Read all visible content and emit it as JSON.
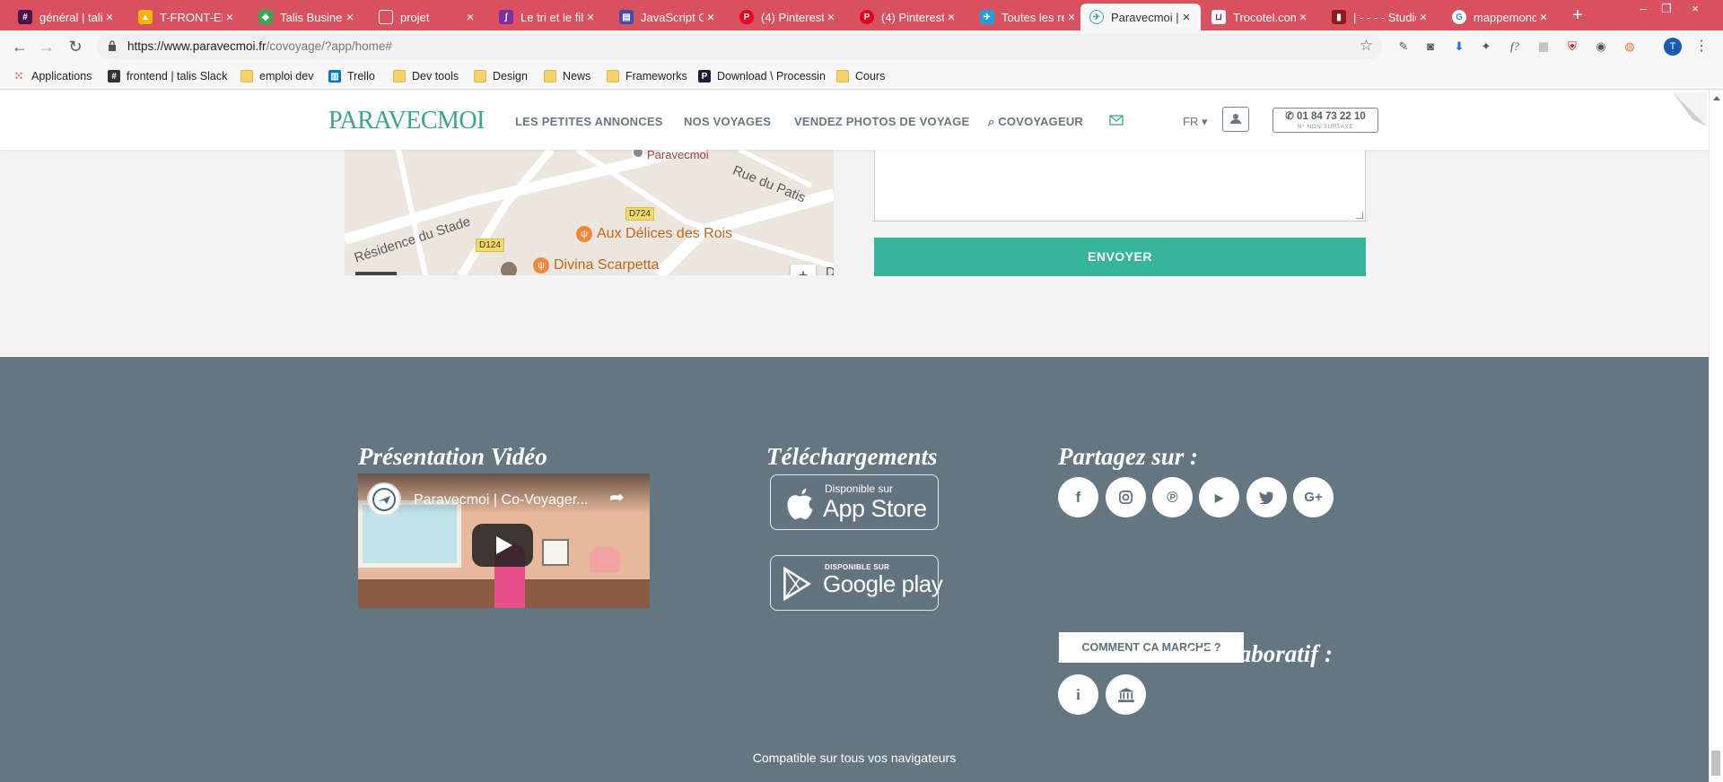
{
  "browser": {
    "tabs": [
      {
        "label": "général | talis",
        "favicon": "slack-icon",
        "color": "#4a154b"
      },
      {
        "label": "T-FRONT-EN",
        "favicon": "drive-icon",
        "color": "#f4b400"
      },
      {
        "label": "Talis Busines",
        "favicon": "maps-icon",
        "color": "#34a853"
      },
      {
        "label": "projet",
        "favicon": "doc-icon",
        "color": "#ffffff"
      },
      {
        "label": "Le tri et le filt",
        "favicon": "bookmark-icon",
        "color": "#7b2fa1"
      },
      {
        "label": "JavaScript Gr",
        "favicon": "js-icon",
        "color": "#3d4fa8"
      },
      {
        "label": "(4) Pinterest",
        "favicon": "pinterest-icon",
        "color": "#e60023"
      },
      {
        "label": "(4) Pinterest",
        "favicon": "pinterest-icon",
        "color": "#e60023"
      },
      {
        "label": "Toutes les re",
        "favicon": "bird-icon",
        "color": "#1e9fd8"
      },
      {
        "label": "Paravecmoi |",
        "favicon": "paravecmoi-icon",
        "color": "#3aa58f",
        "active": true
      },
      {
        "label": "Trocotel.com",
        "favicon": "trocotel-icon",
        "color": "#c8102e"
      },
      {
        "label": "| - - - - Studio",
        "favicon": "studio-icon",
        "color": "#8b1a1a"
      },
      {
        "label": "mappemonde",
        "favicon": "google-icon",
        "color": "#4285f4"
      }
    ],
    "new_tab": "+",
    "url_host": "https://www.paravecmoi.fr",
    "url_path": "/covoyage/?app/home#",
    "bookmarks": [
      {
        "label": "Applications",
        "icon": "apps-grid-icon"
      },
      {
        "label": "frontend | talis Slack",
        "icon": "slack-icon"
      },
      {
        "label": "emploi dev",
        "icon": "folder-icon"
      },
      {
        "label": "Trello",
        "icon": "trello-icon"
      },
      {
        "label": "Dev tools",
        "icon": "folder-icon"
      },
      {
        "label": "Design",
        "icon": "folder-icon"
      },
      {
        "label": "News",
        "icon": "folder-icon"
      },
      {
        "label": "Frameworks",
        "icon": "folder-icon"
      },
      {
        "label": "Download \\ Processin",
        "icon": "processing-icon"
      },
      {
        "label": "Cours",
        "icon": "folder-icon"
      }
    ],
    "profile_initial": "T"
  },
  "site_nav": {
    "logo": "PARAVECMOI",
    "links": [
      "LES PETITES ANNONCES",
      "NOS VOYAGES",
      "VENDEZ PHOTOS DE VOYAGE",
      "COVOYAGEUR"
    ],
    "lang": "FR",
    "phone": "01 84 73 22 10",
    "phone_note": "N° NON SURTAXE",
    "accent": "#3aa58f"
  },
  "map": {
    "place": "Paravecmoi",
    "streets": [
      "Rue du Patis",
      "Résidence du Stade"
    ],
    "road_badges": [
      "D724",
      "D124"
    ],
    "pois": [
      "Aux Délices des Rois",
      "Divina Scarpetta"
    ],
    "zoom_in": "+",
    "edge_letter": "D"
  },
  "contact_form": {
    "send_label": "ENVOYER",
    "button_color": "#36b59b"
  },
  "footer": {
    "background": "#647680",
    "video_heading": "Présentation Vidéo",
    "video_title": "Paravecmoi | Co-Voyager...",
    "downloads_heading": "Téléchargements",
    "appstore_small": "Disponible sur",
    "appstore_large": "App Store",
    "googleplay_small": "DISPONIBLE SUR",
    "googleplay_large": "Google play",
    "compat_text": "Compatible sur tous vos navigateurs",
    "share_heading": "Partagez sur :",
    "social": [
      "facebook-icon",
      "instagram-icon",
      "pinterest-icon",
      "youtube-icon",
      "twitter-icon",
      "google-plus-icon"
    ],
    "how_button": "COMMENT ÇA MARCHE ?",
    "crowdfunding_heading": "Financement Collaboratif :",
    "crowdfunding_icons": [
      "info-icon",
      "bank-icon"
    ]
  }
}
